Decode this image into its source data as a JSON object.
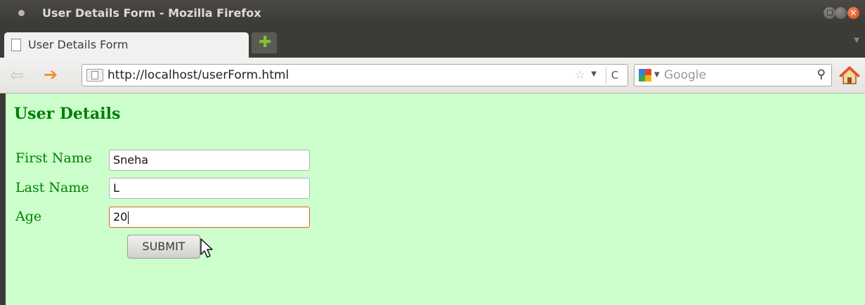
{
  "window": {
    "title": "User Details Form - Mozilla Firefox"
  },
  "tabs": [
    {
      "label": "User Details Form"
    }
  ],
  "navbar": {
    "url": "http://localhost/userForm.html",
    "search_placeholder": "Google",
    "search_engine_icon": "google-icon"
  },
  "page": {
    "background": "#ccffcc",
    "text_color": "#008000",
    "heading": "User Details",
    "fields": [
      {
        "label": "First Name",
        "value": "Sneha"
      },
      {
        "label": "Last Name",
        "value": "L"
      },
      {
        "label": "Age",
        "value": "20",
        "focused": true
      }
    ],
    "submit_label": "SUBMIT"
  },
  "icons": {
    "back": "back-arrow-icon",
    "forward": "forward-arrow-icon",
    "bookmark": "star-icon",
    "reload": "reload-icon",
    "search": "magnifier-icon",
    "home": "home-icon"
  }
}
